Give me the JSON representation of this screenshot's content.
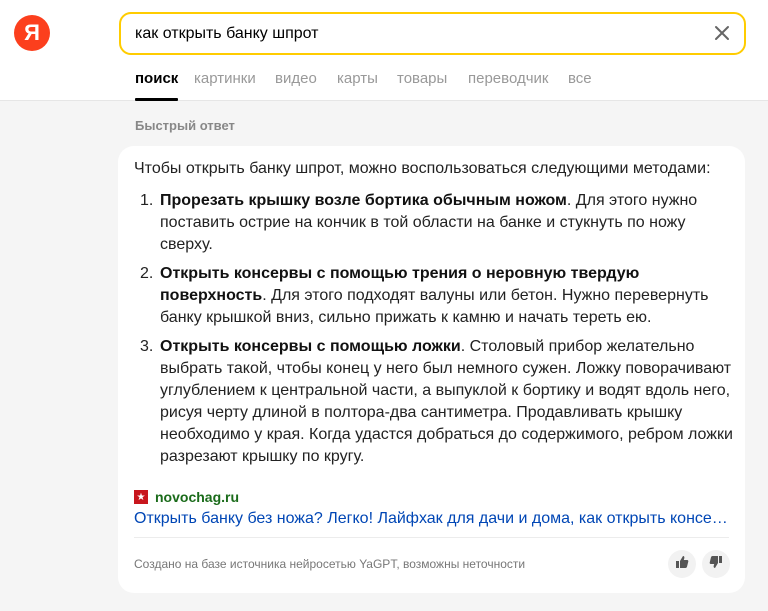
{
  "header": {
    "logo_text": "Я",
    "search": {
      "query": "как открыть банку шпрот"
    },
    "tabs": [
      {
        "label": "поиск",
        "active": true
      },
      {
        "label": "картинки",
        "active": false
      },
      {
        "label": "видео",
        "active": false
      },
      {
        "label": "карты",
        "active": false
      },
      {
        "label": "товары",
        "active": false
      },
      {
        "label": "переводчик",
        "active": false
      },
      {
        "label": "все",
        "active": false
      }
    ]
  },
  "quick_answer": {
    "section_label": "Быстрый ответ",
    "intro": "Чтобы открыть банку шпрот, можно воспользоваться следующими методами:",
    "items": [
      {
        "number": "1.",
        "title": "Прорезать крышку возле бортика обычным ножом",
        "text": ". Для этого нужно поставить острие на кончик в той области на банке и стукнуть по ножу сверху."
      },
      {
        "number": "2.",
        "title": "Открыть консервы с помощью трения о неровную твердую поверхность",
        "text": ". Для этого подходят валуны или бетон. Нужно перевернуть банку крышкой вниз, сильно прижать к камню и начать тереть ею."
      },
      {
        "number": "3.",
        "title": "Открыть консервы с помощью ложки",
        "text": ". Столовый прибор желательно выбрать такой, чтобы конец у него был немного сужен. Ложку поворачивают углублением к центральной части, а выпуклой к бортику и водят вдоль него, рисуя черту длиной в полтора-два сантиметра. Продавливать крышку необходимо у края. Когда удастся добраться до содержимого, ребром ложки разрезают крышку по кругу."
      }
    ],
    "source": {
      "icon_glyph": "★",
      "site": "novochag.ru",
      "link_text": "Открыть банку без ножа? Легко! Лайфхак для дачи и дома, как открыть консерв..."
    },
    "footnote": "Создано на базе источника нейросетью YaGPT, возможны неточности"
  },
  "colors": {
    "accent": "#ffcc00",
    "logo": "#fc3f1d",
    "link": "#0046b5",
    "source_site": "#1a6b1a"
  },
  "icons": {
    "clear": "close-icon",
    "like": "thumbs-up-icon",
    "dislike": "thumbs-down-icon"
  }
}
